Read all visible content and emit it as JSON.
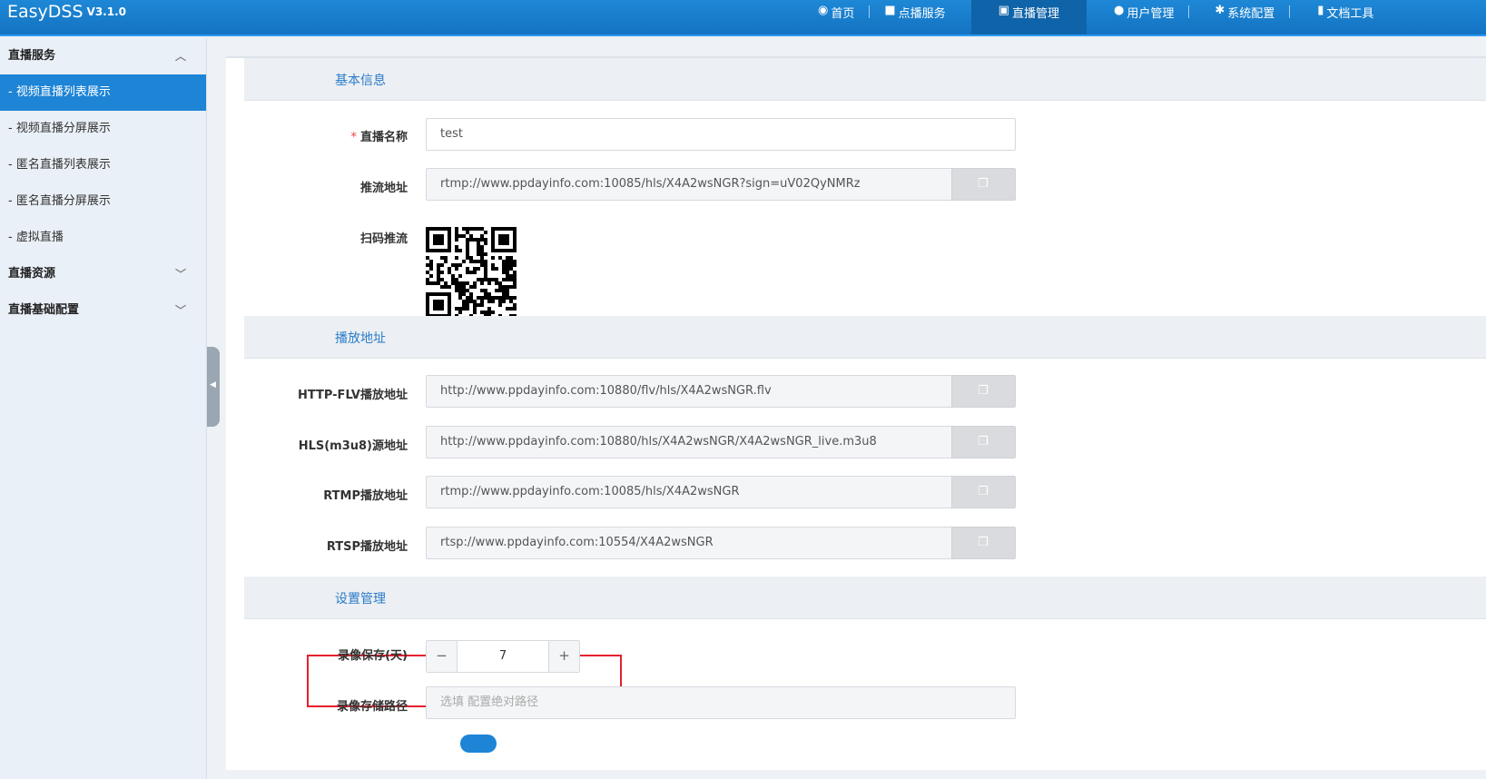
{
  "app": {
    "name": "EasyDSS",
    "version": "V3.1.0"
  },
  "nav": [
    {
      "icon": "dashboard-icon",
      "glyph": "◉",
      "label": "首页"
    },
    {
      "icon": "video-camera-icon",
      "glyph": "■",
      "label": "点播服务"
    },
    {
      "icon": "live-tv-icon",
      "glyph": "▣",
      "label": "直播管理"
    },
    {
      "icon": "user-icon",
      "glyph": "●",
      "label": "用户管理"
    },
    {
      "icon": "gear-icon",
      "glyph": "✱",
      "label": "系统配置"
    },
    {
      "icon": "document-icon",
      "glyph": "▮",
      "label": "文档工具"
    }
  ],
  "sidebar": {
    "group_live_service": "直播服务",
    "items": [
      "- 视频直播列表展示",
      "- 视频直播分屏展示",
      "- 匿名直播列表展示",
      "- 匿名直播分屏展示",
      "- 虚拟直播"
    ],
    "group_live_resources": "直播资源",
    "group_live_config": "直播基础配置"
  },
  "basic_info": {
    "title": "基本信息",
    "name_label": "直播名称",
    "name_value": "test",
    "push_label": "推流地址",
    "push_value": "rtmp://www.ppdayinfo.com:10085/hls/X4A2wsNGR?sign=uV02QyNMRz",
    "qr_label": "扫码推流"
  },
  "play": {
    "title": "播放地址",
    "rows": [
      {
        "label": "HTTP-FLV播放地址",
        "value": "http://www.ppdayinfo.com:10880/flv/hls/X4A2wsNGR.flv"
      },
      {
        "label": "HLS(m3u8)源地址",
        "value": "http://www.ppdayinfo.com:10880/hls/X4A2wsNGR/X4A2wsNGR_live.m3u8"
      },
      {
        "label": "RTMP播放地址",
        "value": "rtmp://www.ppdayinfo.com:10085/hls/X4A2wsNGR"
      },
      {
        "label": "RTSP播放地址",
        "value": "rtsp://www.ppdayinfo.com:10554/X4A2wsNGR"
      }
    ]
  },
  "settings": {
    "title": "设置管理",
    "record_days_label": "录像保存(天)",
    "record_days_value": "7",
    "minus": "−",
    "plus": "+",
    "record_path_label": "录像存储路径",
    "record_path_placeholder": "选填 配置绝对路径"
  },
  "colors": {
    "accent": "#1d84d6",
    "highlight": "#e5202e"
  }
}
